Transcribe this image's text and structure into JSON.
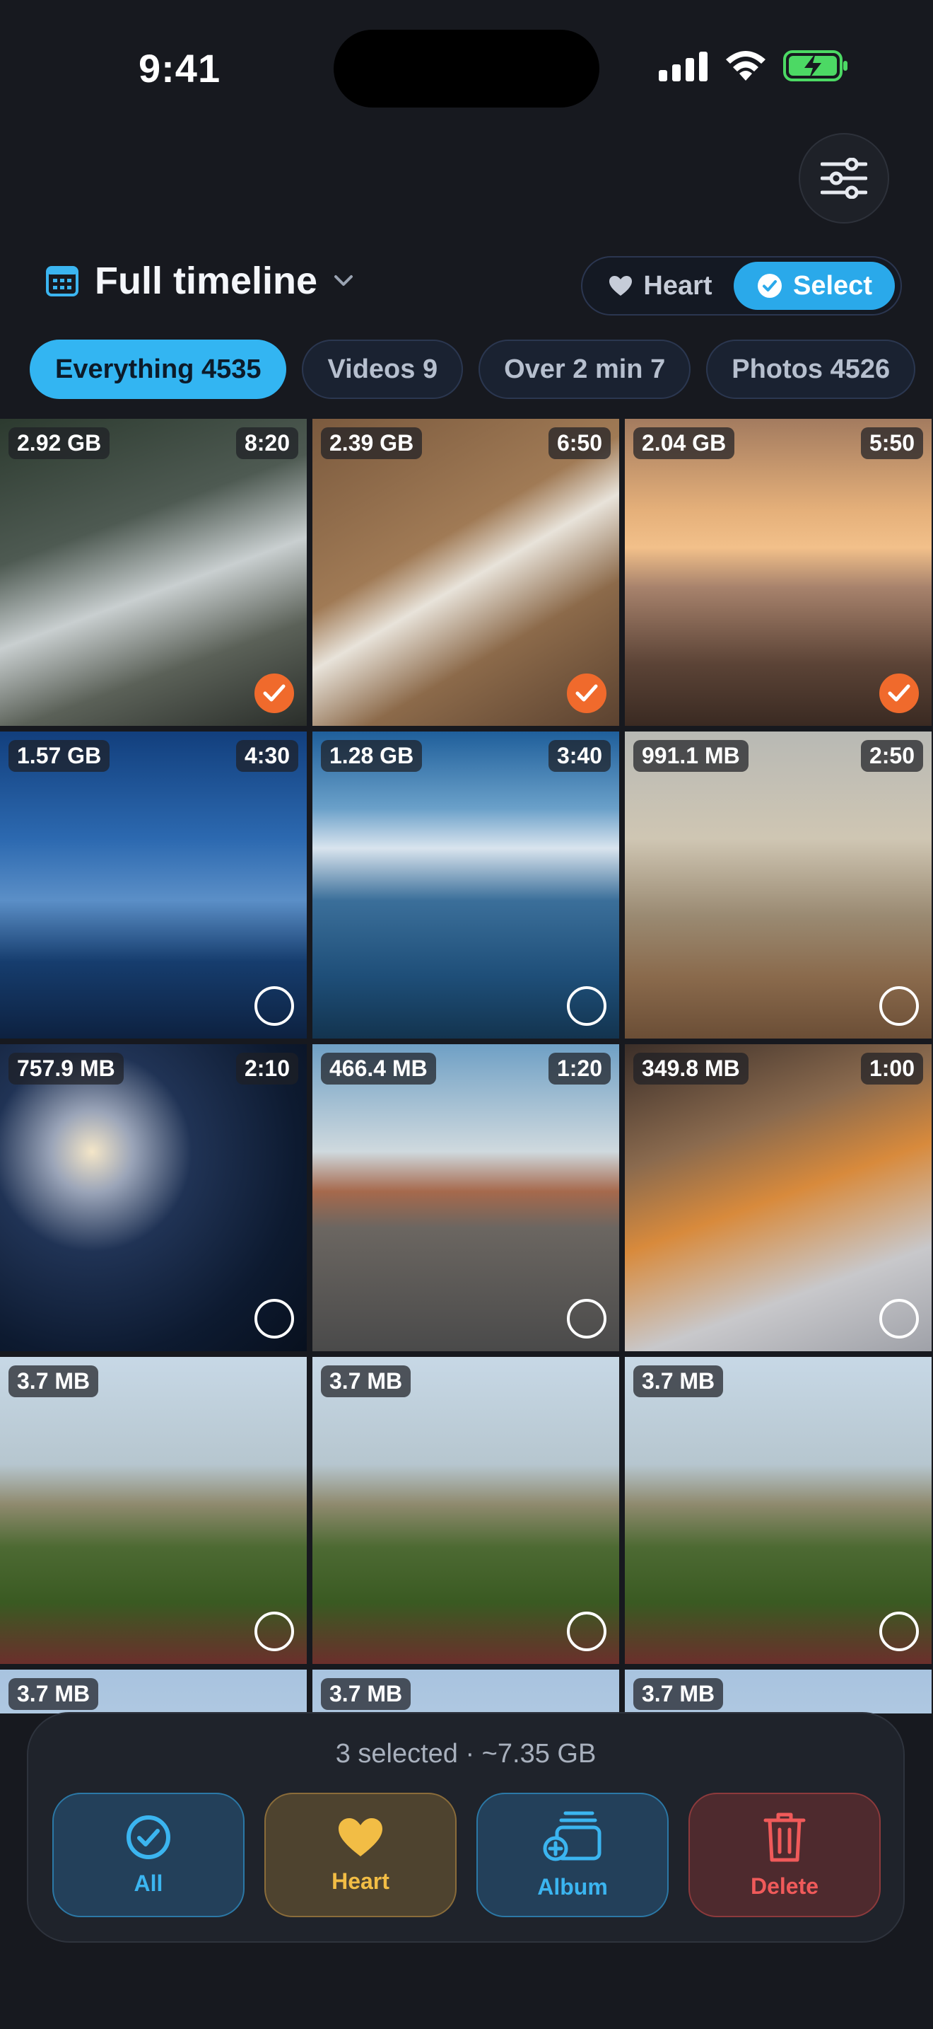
{
  "status_bar": {
    "time": "9:41"
  },
  "header": {
    "timeline_label": "Full timeline"
  },
  "mode_toggle": {
    "heart_label": "Heart",
    "select_label": "Select"
  },
  "filters": [
    {
      "label": "Everything 4535",
      "active": true
    },
    {
      "label": "Videos 9",
      "active": false
    },
    {
      "label": "Over 2 min 7",
      "active": false
    },
    {
      "label": "Photos 4526",
      "active": false
    }
  ],
  "grid": [
    {
      "size": "2.92 GB",
      "duration": "8:20",
      "selected": true,
      "scene": "waterfall"
    },
    {
      "size": "2.39 GB",
      "duration": "6:50",
      "selected": true,
      "scene": "food"
    },
    {
      "size": "2.04 GB",
      "duration": "5:50",
      "selected": true,
      "scene": "sunset-beach"
    },
    {
      "size": "1.57 GB",
      "duration": "4:30",
      "selected": false,
      "scene": "snow-cabin"
    },
    {
      "size": "1.28 GB",
      "duration": "3:40",
      "selected": false,
      "scene": "mountain-lake"
    },
    {
      "size": "991.1 MB",
      "duration": "2:50",
      "selected": false,
      "scene": "autumn-forest"
    },
    {
      "size": "757.9 MB",
      "duration": "2:10",
      "selected": false,
      "scene": "fireworks"
    },
    {
      "size": "466.4 MB",
      "duration": "1:20",
      "selected": false,
      "scene": "desert-road"
    },
    {
      "size": "349.8 MB",
      "duration": "1:00",
      "selected": false,
      "scene": "sleeping-dog"
    },
    {
      "size": "3.7 MB",
      "duration": "",
      "selected": false,
      "scene": "flower-dune"
    },
    {
      "size": "3.7 MB",
      "duration": "",
      "selected": false,
      "scene": "flower-dune"
    },
    {
      "size": "3.7 MB",
      "duration": "",
      "selected": false,
      "scene": "flower-dune"
    },
    {
      "size": "3.7 MB",
      "duration": "",
      "selected": false,
      "scene": "sky"
    },
    {
      "size": "3.7 MB",
      "duration": "",
      "selected": false,
      "scene": "sky"
    },
    {
      "size": "3.7 MB",
      "duration": "",
      "selected": false,
      "scene": "sky"
    }
  ],
  "action_panel": {
    "summary": "3 selected · ~7.35 GB",
    "all_label": "All",
    "heart_label": "Heart",
    "album_label": "Album",
    "delete_label": "Delete"
  },
  "colors": {
    "accent": "#33b5f2",
    "selected_check": "#f06a2c",
    "heart": "#f2bd45",
    "delete": "#f05a5a",
    "background": "#17191f"
  }
}
